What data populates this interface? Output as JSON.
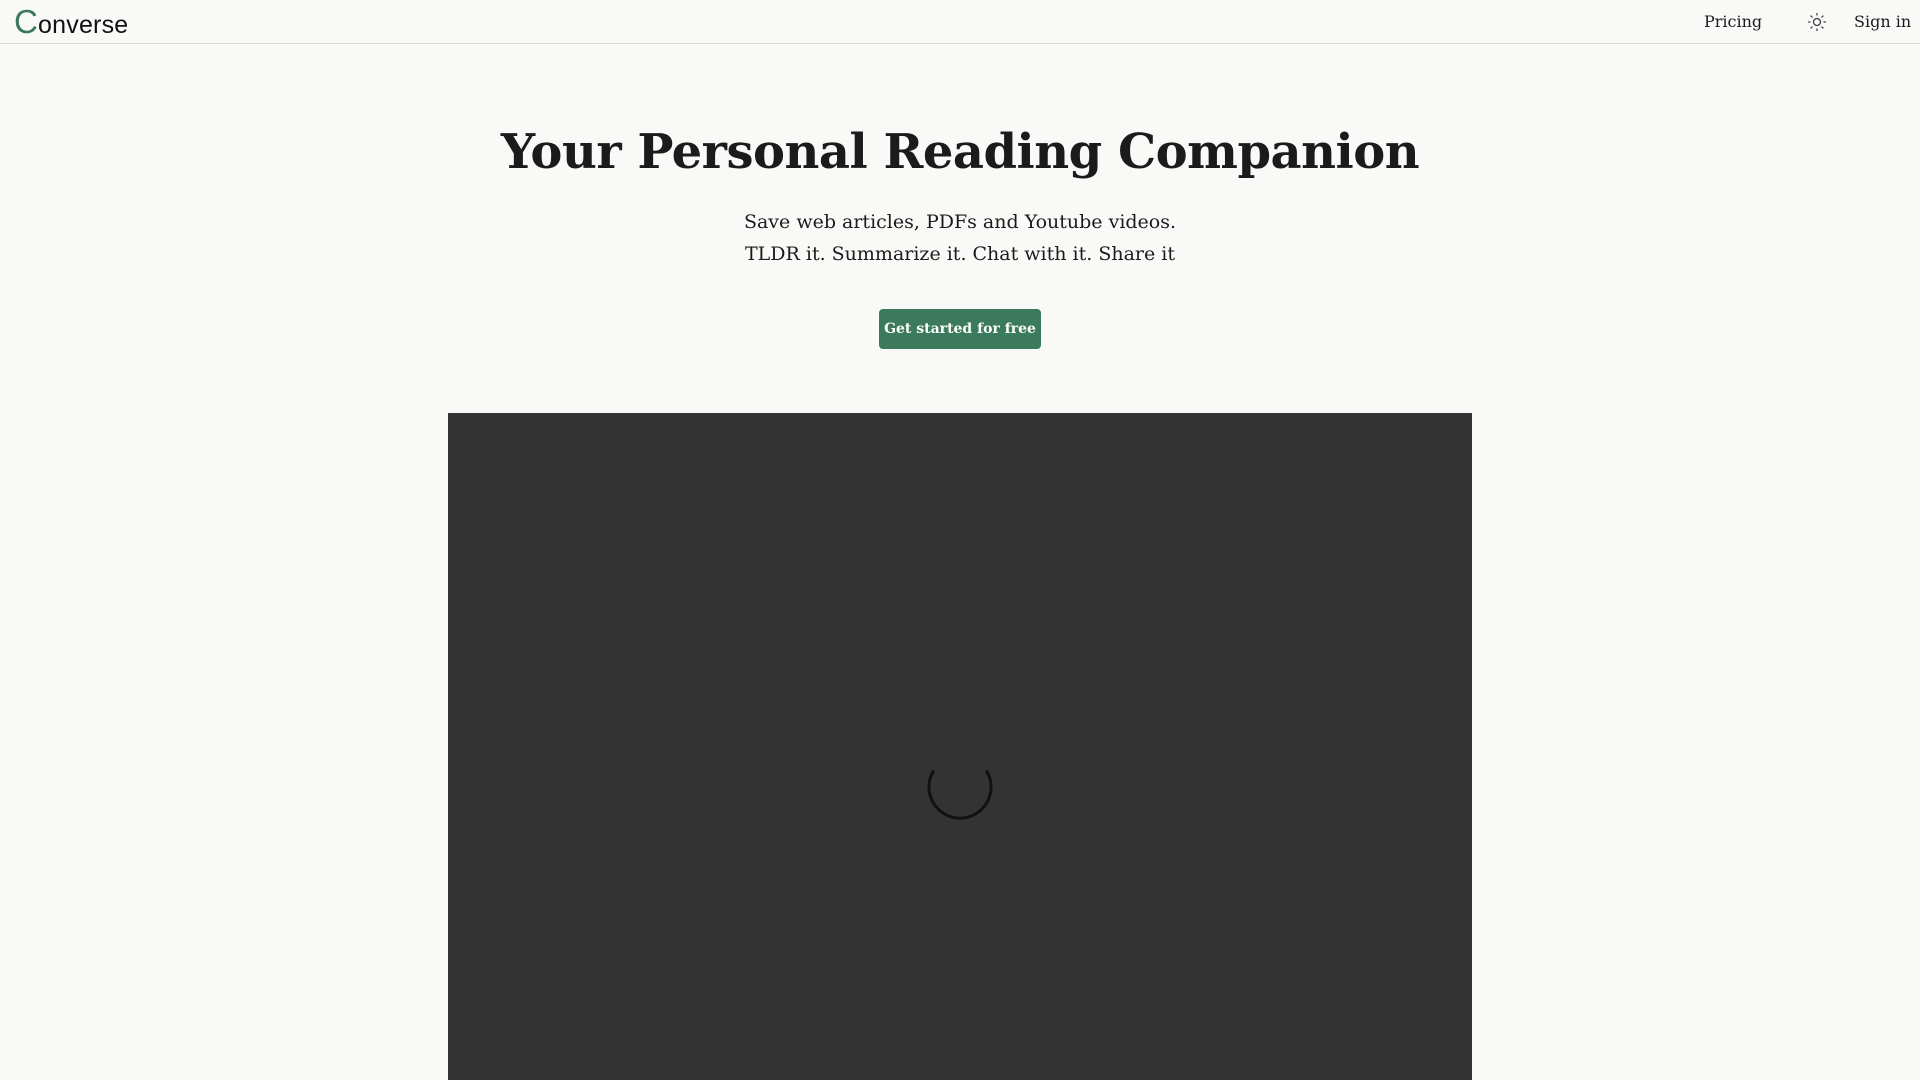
{
  "header": {
    "logo_initial": "C",
    "logo_rest": "onverse",
    "nav": {
      "pricing_label": "Pricing",
      "theme_icon": "sun-icon",
      "signin_label": "Sign in"
    }
  },
  "hero": {
    "title": "Your Personal Reading Companion",
    "subtitle_line1": "Save web articles, PDFs and Youtube videos.",
    "subtitle_line2": "TLDR it. Summarize it. Chat with it. Share it",
    "cta_label": "Get started for free"
  },
  "media": {
    "state": "loading",
    "spinner_icon": "loading-spinner-icon"
  },
  "colors": {
    "brand_green": "#3b7a5c",
    "background": "#f9f9f7",
    "video_bg": "#333333"
  }
}
